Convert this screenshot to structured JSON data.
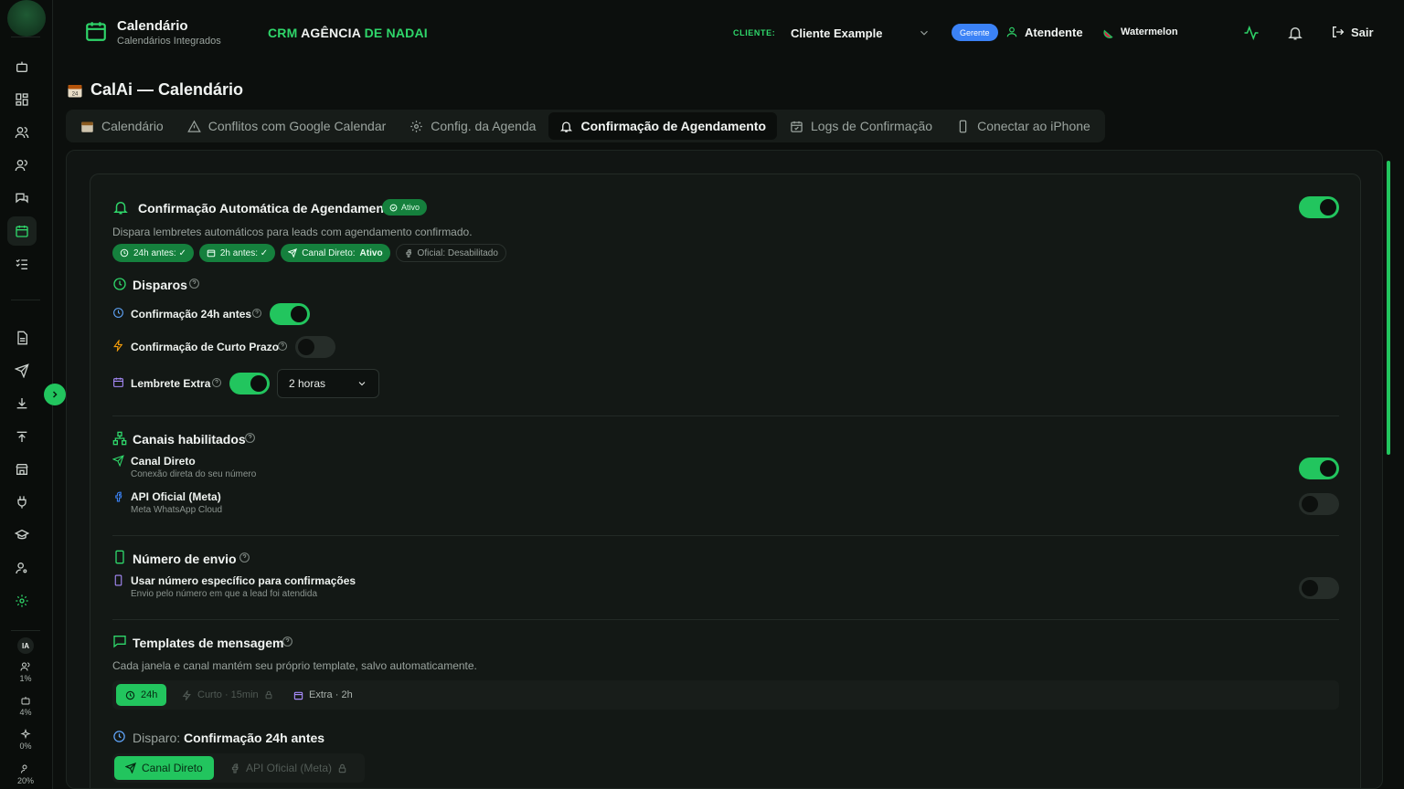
{
  "header": {
    "app_title": "Calendário",
    "app_subtitle": "Calendários Integrados",
    "brand_prefix": "CRM",
    "brand_middle": "AGÊNCIA",
    "brand_suffix": "DE NADAI",
    "client_label": "CLIENTE:",
    "client_value": "Cliente Example",
    "role_badge": "Gerente",
    "user_name": "Atendente",
    "workspace_name": "Watermelon",
    "logout_label": "Sair"
  },
  "sidebar": {
    "ia_label": "IA",
    "stats": [
      {
        "icon": "users-icon",
        "value": "1%"
      },
      {
        "icon": "bot-icon",
        "value": "4%"
      },
      {
        "icon": "sparkles-icon",
        "value": "0%"
      },
      {
        "icon": "user-cog-icon",
        "value": "20%"
      }
    ]
  },
  "page": {
    "title": "CalAi — Calendário",
    "tabs": [
      {
        "label": "Calendário",
        "icon": "calendar-emoji-icon"
      },
      {
        "label": "Conflitos com Google Calendar",
        "icon": "warning-icon"
      },
      {
        "label": "Config. da Agenda",
        "icon": "gear-icon"
      },
      {
        "label": "Confirmação de Agendamento",
        "icon": "bell-icon",
        "active": true
      },
      {
        "label": "Logs de Confirmação",
        "icon": "calendar-check-icon"
      },
      {
        "label": "Conectar ao iPhone",
        "icon": "phone-icon"
      }
    ]
  },
  "confirmation": {
    "title": "Confirmação Automática de Agendamento",
    "status": "Ativo",
    "enabled": true,
    "description": "Dispara lembretes automáticos para leads com agendamento confirmado.",
    "chips": {
      "c24h": "24h antes: ✓",
      "c2h": "2h antes: ✓",
      "direct_label": "Canal Direto:",
      "direct_value": "Ativo",
      "official": "Oficial: Desabilitado"
    }
  },
  "disparos": {
    "title": "Disparos",
    "items": [
      {
        "label": "Confirmação 24h antes",
        "enabled": true
      },
      {
        "label": "Confirmação de Curto Prazo",
        "enabled": false
      },
      {
        "label": "Lembrete Extra",
        "enabled": true
      }
    ],
    "extra_select_value": "2 horas"
  },
  "canais": {
    "title": "Canais habilitados",
    "items": [
      {
        "label": "Canal Direto",
        "sub": "Conexão direta do seu número",
        "enabled": true
      },
      {
        "label": "API Oficial (Meta)",
        "sub": "Meta WhatsApp Cloud",
        "enabled": false
      }
    ]
  },
  "numero": {
    "title": "Número de envio",
    "label": "Usar número específico para confirmações",
    "sub": "Envio pelo número em que a lead foi atendida",
    "enabled": false
  },
  "templates": {
    "title": "Templates de mensagem",
    "description": "Cada janela e canal mantém seu próprio template, salvo automaticamente.",
    "tabs": [
      "24h",
      "Curto · 15min",
      "Extra · 2h"
    ],
    "disparo_label": "Disparo:",
    "disparo_value": "Confirmação 24h antes",
    "channel_tabs": [
      "Canal Direto",
      "API Oficial (Meta)"
    ]
  },
  "colors": {
    "accent": "#22c55e",
    "background": "#0c0f0d",
    "role_badge": "#3b82f6"
  }
}
